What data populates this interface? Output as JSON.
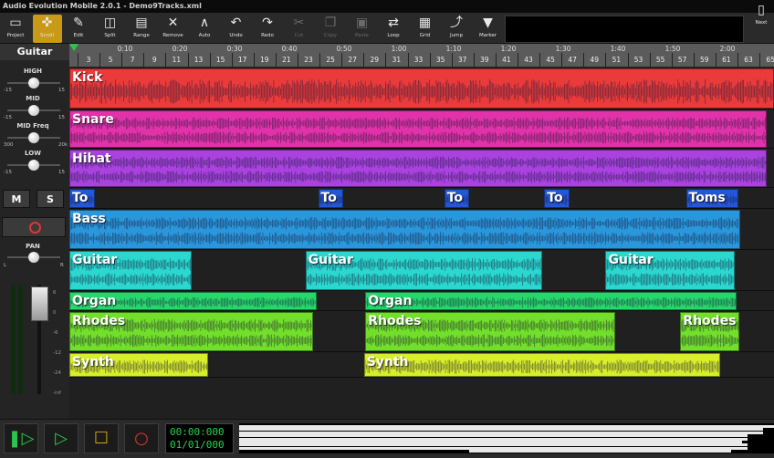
{
  "window": {
    "title": "Audio Evolution Mobile 2.0.1 - Demo9Tracks.xml"
  },
  "toolbar": {
    "items": [
      {
        "label": "Project",
        "icon": "folder-icon"
      },
      {
        "label": "Scroll",
        "icon": "scroll-icon",
        "active": true
      },
      {
        "label": "Edit",
        "icon": "edit-icon"
      },
      {
        "label": "Split",
        "icon": "split-icon"
      },
      {
        "label": "Range",
        "icon": "range-icon"
      },
      {
        "label": "Remove",
        "icon": "remove-icon"
      },
      {
        "label": "Auto",
        "icon": "automation-icon"
      },
      {
        "label": "Undo",
        "icon": "undo-icon"
      },
      {
        "label": "Redo",
        "icon": "redo-icon"
      },
      {
        "label": "Cut",
        "icon": "cut-icon",
        "disabled": true
      },
      {
        "label": "Copy",
        "icon": "copy-icon",
        "disabled": true
      },
      {
        "label": "Paste",
        "icon": "paste-icon",
        "disabled": true
      },
      {
        "label": "Loop",
        "icon": "loop-icon"
      },
      {
        "label": "Grid",
        "icon": "grid-icon"
      },
      {
        "label": "Jump",
        "icon": "jump-icon"
      },
      {
        "label": "Marker",
        "icon": "marker-icon"
      }
    ],
    "next_label": "Next"
  },
  "track_panel": {
    "selected_track": "Guitar",
    "eq": [
      {
        "label": "HIGH",
        "min": "-15",
        "max": "15",
        "value": 0.5
      },
      {
        "label": "MID",
        "min": "-15",
        "max": "15",
        "value": 0.5
      },
      {
        "label": "MID Freq",
        "min": "300",
        "max": "20k",
        "value": 0.5
      },
      {
        "label": "LOW",
        "min": "-15",
        "max": "15",
        "value": 0.5
      }
    ],
    "mute_label": "M",
    "solo_label": "S",
    "pan": {
      "label": "PAN",
      "left": "L",
      "right": "R",
      "value": 0.5
    },
    "fader_scale": [
      "6",
      "0",
      "-6",
      "-12",
      "-24",
      "-inf"
    ]
  },
  "ruler": {
    "time_labels": [
      "0:10",
      "0:20",
      "0:30",
      "0:40",
      "0:50",
      "1:00",
      "1:10",
      "1:20",
      "1:30",
      "1:40",
      "1:50",
      "2:00"
    ],
    "bar_labels": [
      "3",
      "5",
      "7",
      "9",
      "11",
      "13",
      "15",
      "17",
      "19",
      "21",
      "23",
      "25",
      "27",
      "29",
      "31",
      "33",
      "35",
      "37",
      "39",
      "41",
      "43",
      "45",
      "47",
      "49",
      "51",
      "53",
      "55",
      "57",
      "59",
      "61",
      "63",
      "65"
    ]
  },
  "tracks": [
    {
      "name": "Kick",
      "color": "#ea3a3a",
      "stereo": false,
      "clips": [
        {
          "label": "Kick",
          "start": 0,
          "end": 1.0
        }
      ]
    },
    {
      "name": "Snare",
      "color": "#e232a9",
      "stereo": true,
      "clips": [
        {
          "label": "Snare",
          "start": 0,
          "end": 0.99
        }
      ]
    },
    {
      "name": "Hihat",
      "color": "#a942df",
      "stereo": true,
      "clips": [
        {
          "label": "Hihat",
          "start": 0,
          "end": 0.99
        }
      ]
    },
    {
      "name": "Toms",
      "color": "#2457d8",
      "stereo": false,
      "clips": [
        {
          "label": "To",
          "start": 0,
          "end": 0.036
        },
        {
          "label": "To",
          "start": 0.353,
          "end": 0.389
        },
        {
          "label": "To",
          "start": 0.532,
          "end": 0.568
        },
        {
          "label": "To",
          "start": 0.674,
          "end": 0.71
        },
        {
          "label": "Toms",
          "start": 0.875,
          "end": 0.95
        }
      ]
    },
    {
      "name": "Bass",
      "color": "#2a97dc",
      "stereo": true,
      "clips": [
        {
          "label": "Bass",
          "start": 0,
          "end": 0.952
        }
      ]
    },
    {
      "name": "Guitar",
      "color": "#2ad8d0",
      "stereo": true,
      "clips": [
        {
          "label": "Guitar",
          "start": 0,
          "end": 0.173
        },
        {
          "label": "Guitar",
          "start": 0.335,
          "end": 0.671
        },
        {
          "label": "Guitar",
          "start": 0.761,
          "end": 0.944
        }
      ]
    },
    {
      "name": "Organ",
      "color": "#26d86c",
      "stereo": false,
      "clips": [
        {
          "label": "Organ",
          "start": 0,
          "end": 0.351
        },
        {
          "label": "Organ",
          "start": 0.42,
          "end": 0.947
        }
      ]
    },
    {
      "name": "Rhodes",
      "color": "#72df2a",
      "stereo": true,
      "clips": [
        {
          "label": "Rhodes",
          "start": 0,
          "end": 0.346
        },
        {
          "label": "Rhodes",
          "start": 0.42,
          "end": 0.774
        },
        {
          "label": "Rhodes",
          "start": 0.867,
          "end": 0.951
        }
      ]
    },
    {
      "name": "Synth",
      "color": "#d8ee2a",
      "stereo": false,
      "clips": [
        {
          "label": "Synth",
          "start": 0,
          "end": 0.197
        },
        {
          "label": "Synth",
          "start": 0.418,
          "end": 0.924
        }
      ]
    }
  ],
  "transport": {
    "time": "00:00:000",
    "date": "01/01/000"
  },
  "colors": {
    "accent": "#c89a18",
    "transport_green": "#2ec34a",
    "record_red": "#e0372d"
  }
}
